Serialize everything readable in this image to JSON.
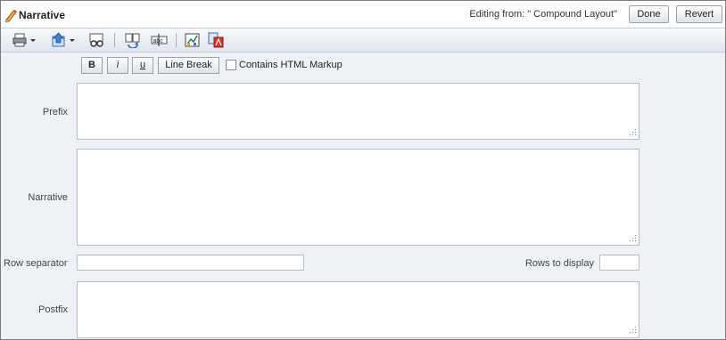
{
  "header": {
    "title": "Narrative",
    "editing_text": "Editing from: \" Compound Layout\"",
    "done_label": "Done",
    "revert_label": "Revert"
  },
  "toolbar": {
    "icons": [
      "print-icon",
      "export-icon",
      "preview-icon",
      "refresh-icon",
      "text-field-icon",
      "chart-icon",
      "pdf-icon"
    ]
  },
  "format": {
    "bold_label": "B",
    "italic_label": "i",
    "underline_label": "u",
    "line_break_label": "Line Break",
    "html_markup_label": "Contains HTML Markup",
    "html_markup_checked": false
  },
  "fields": {
    "prefix_label": "Prefix",
    "prefix_value": "",
    "narrative_label": "Narrative",
    "narrative_value": "",
    "row_separator_label": "Row separator",
    "row_separator_value": "",
    "rows_to_display_label": "Rows to display",
    "rows_to_display_value": "",
    "postfix_label": "Postfix",
    "postfix_value": ""
  }
}
